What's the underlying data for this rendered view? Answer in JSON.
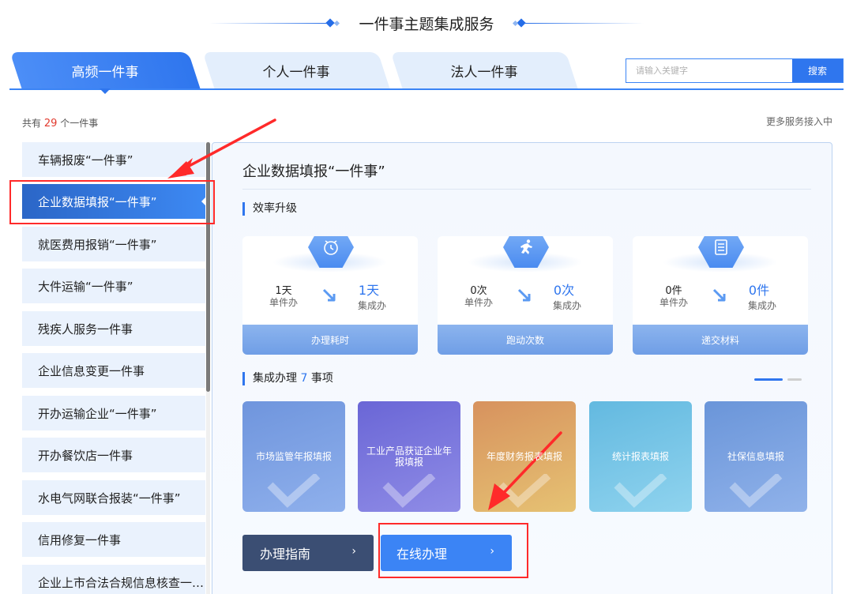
{
  "header": {
    "title": "一件事主题集成服务"
  },
  "tabs": [
    {
      "label": "高频一件事",
      "active": true
    },
    {
      "label": "个人一件事",
      "active": false
    },
    {
      "label": "法人一件事",
      "active": false
    }
  ],
  "search": {
    "placeholder": "请输入关键字",
    "button_label": "搜索"
  },
  "summary": {
    "prefix": "共有",
    "count": "29",
    "suffix": "个一件事",
    "more_label": "更多服务接入中"
  },
  "sidebar": {
    "items": [
      {
        "label": "车辆报废“一件事”"
      },
      {
        "label": "企业数据填报“一件事”",
        "active": true
      },
      {
        "label": "就医费用报销“一件事”"
      },
      {
        "label": "大件运输“一件事”"
      },
      {
        "label": "残疾人服务一件事"
      },
      {
        "label": "企业信息变更一件事"
      },
      {
        "label": "开办运输企业“一件事”"
      },
      {
        "label": "开办餐饮店一件事"
      },
      {
        "label": "水电气网联合报装“一件事”"
      },
      {
        "label": "信用修复一件事"
      },
      {
        "label": "企业上市合法合规信息核查一…"
      }
    ]
  },
  "main": {
    "title": "企业数据填报“一件事”",
    "efficiency": {
      "heading": "效率升级",
      "stats": [
        {
          "icon": "clock-icon",
          "single_value": "1天",
          "single_label": "单件办",
          "combined_value": "1天",
          "combined_label": "集成办",
          "footer": "办理耗时"
        },
        {
          "icon": "running-person-icon",
          "single_value": "0次",
          "single_label": "单件办",
          "combined_value": "0次",
          "combined_label": "集成办",
          "footer": "跑动次数"
        },
        {
          "icon": "document-icon",
          "single_value": "0件",
          "single_label": "单件办",
          "combined_value": "0件",
          "combined_label": "集成办",
          "footer": "递交材料"
        }
      ]
    },
    "integrated": {
      "heading_prefix": "集成办理",
      "count": "7",
      "heading_suffix": "事项",
      "items": [
        {
          "label": "市场监管年报填报"
        },
        {
          "label": "工业产品获证企业年报填报"
        },
        {
          "label": "年度财务报表填报"
        },
        {
          "label": "统计报表填报"
        },
        {
          "label": "社保信息填报"
        }
      ]
    },
    "buttons": {
      "guide_label": "办理指南",
      "online_label": "在线办理",
      "chevron": "›"
    }
  },
  "colors": {
    "accent": "#2f76ee",
    "highlight_red": "#ff2a2a",
    "count_red": "#e23a2e"
  }
}
